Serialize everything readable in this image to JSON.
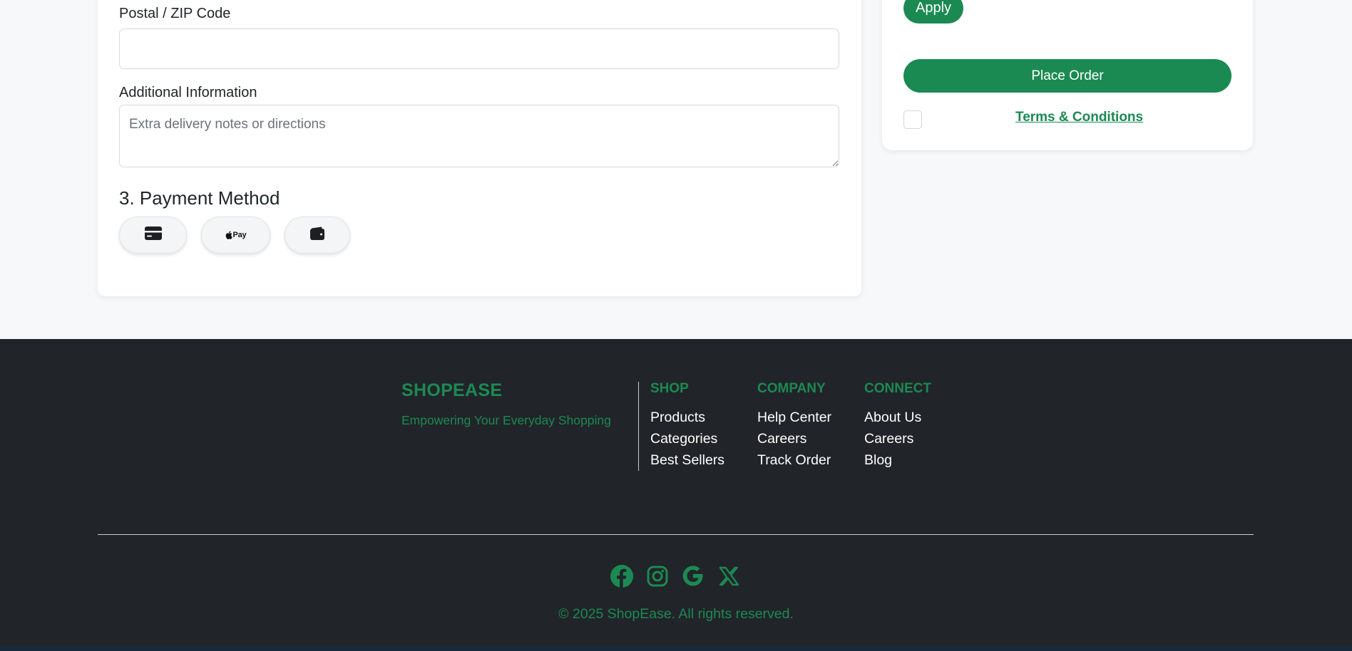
{
  "form": {
    "postal_label": "Postal / ZIP Code",
    "postal_value": "",
    "additional_info_label": "Additional Information",
    "additional_info_placeholder": "Extra delivery notes or directions",
    "payment_heading": "3. Payment Method",
    "payment_methods": [
      {
        "icon": "credit-card-icon",
        "label": ""
      },
      {
        "icon": "apple-pay-icon",
        "label": "Pay"
      },
      {
        "icon": "wallet-icon",
        "label": ""
      }
    ]
  },
  "summary": {
    "apply_label": "Apply",
    "place_order_label": "Place Order",
    "terms_label": "Terms & Conditions"
  },
  "footer": {
    "brand": "SHOPEASE",
    "tagline": "Empowering Your Everyday Shopping",
    "columns": [
      {
        "heading": "SHOP",
        "links": [
          "Products",
          "Categories",
          "Best Sellers"
        ]
      },
      {
        "heading": "COMPANY",
        "links": [
          "Help Center",
          "Careers",
          "Track Order"
        ]
      },
      {
        "heading": "CONNECT",
        "links": [
          "About Us",
          "Careers",
          "Blog"
        ]
      }
    ],
    "social": [
      "facebook-icon",
      "instagram-icon",
      "google-icon",
      "x-icon"
    ],
    "copyright": "© 2025 ShopEase. All rights reserved."
  },
  "colors": {
    "accent": "#1b8a52",
    "footer_bg": "#212429",
    "page_bg": "#f7f8fa"
  }
}
